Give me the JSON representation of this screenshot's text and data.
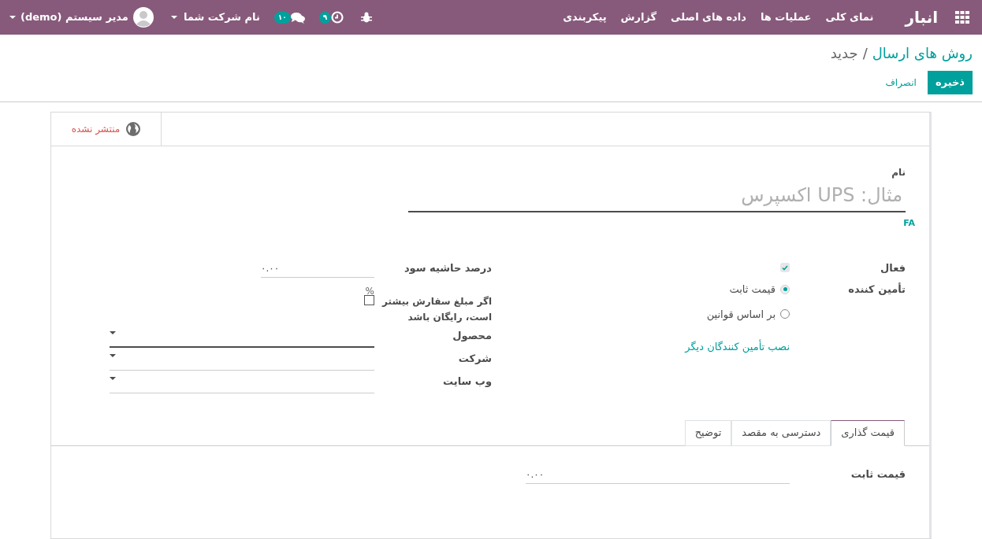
{
  "navbar": {
    "brand": "انبار",
    "menus": [
      "نمای کلی",
      "عملیات ها",
      "داده های اصلی",
      "گزارش",
      "پیکربندی"
    ],
    "systray": [
      {
        "kind": "bug"
      },
      {
        "kind": "activity",
        "count": "۹"
      },
      {
        "kind": "messages",
        "count": "۱۰"
      }
    ],
    "company": "نام شرکت شما",
    "user": "مدیر سیستم (demo)"
  },
  "breadcrumb": {
    "parent": "روش های ارسال",
    "separator": "/",
    "current": "جدید"
  },
  "buttons": [
    {
      "label": "ذخیره",
      "kind": "primary"
    },
    {
      "label": "انصراف",
      "kind": "link"
    }
  ],
  "publish_button": {
    "label": "منتشر نشده"
  },
  "name_field": {
    "label": "نام",
    "placeholder": "مثال: UPS اکسپرس",
    "lang": "FA"
  },
  "main_group": {
    "active": {
      "label": "فعال",
      "checked": true
    },
    "provider": {
      "label": "تأمین کننده",
      "options": [
        {
          "label": "قیمت ثابت",
          "selected": true
        },
        {
          "label": "بر اساس قوانین",
          "selected": false
        }
      ]
    },
    "install_link": "نصب تأمین کنندگان دیگر"
  },
  "side_group": {
    "margin": {
      "label": "درصد حاشیه سود",
      "value": "۰.۰۰",
      "unit": "%"
    },
    "free_over": {
      "label": "اگر مبلغ سفارش بیشتر است، رایگان باشد",
      "checked": false
    },
    "selects": [
      {
        "label": "محصول",
        "focused": true
      },
      {
        "label": "شرکت",
        "focused": false
      },
      {
        "label": "وب سایت",
        "focused": false
      }
    ]
  },
  "tabs": [
    {
      "label": "قیمت گذاری",
      "selected": true
    },
    {
      "label": "دسترسی به مقصد",
      "selected": false
    },
    {
      "label": "توضیح",
      "selected": false
    }
  ],
  "tab_content": {
    "label": "قیمت ثابت",
    "value": "۰.۰۰"
  }
}
